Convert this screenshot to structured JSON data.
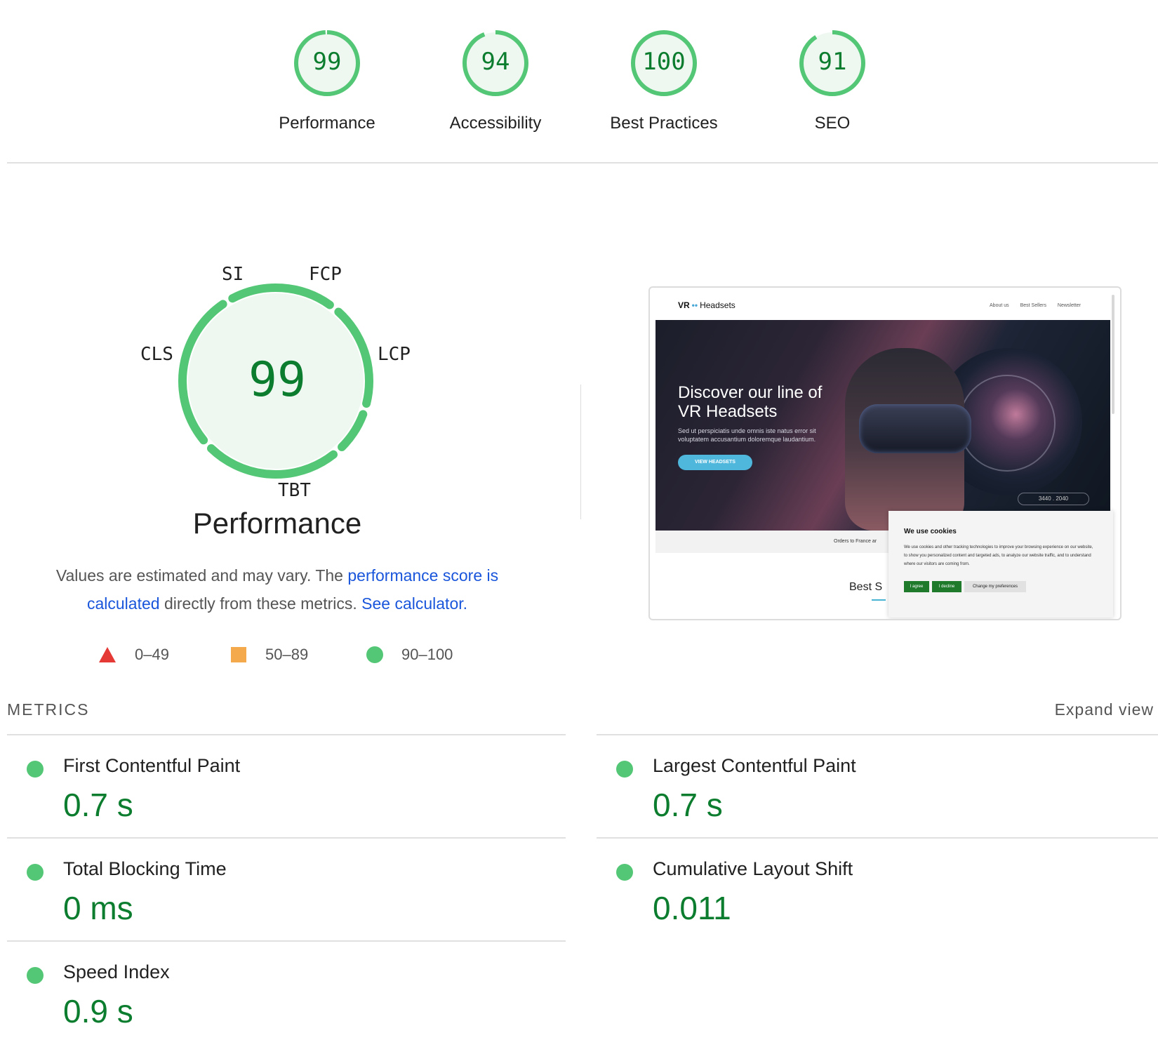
{
  "categories": [
    {
      "score": "99",
      "label": "Performance"
    },
    {
      "score": "94",
      "label": "Accessibility"
    },
    {
      "score": "100",
      "label": "Best Practices"
    },
    {
      "score": "91",
      "label": "SEO"
    }
  ],
  "performance": {
    "score": "99",
    "title": "Performance",
    "gauge_labels": {
      "si": "SI",
      "fcp": "FCP",
      "cls": "CLS",
      "lcp": "LCP",
      "tbt": "TBT"
    },
    "desc_pre": "Values are estimated and may vary. The ",
    "desc_link1": "performance score is calculated",
    "desc_mid": " directly from these metrics. ",
    "desc_link2": "See calculator."
  },
  "legend": [
    {
      "icon": "triangle-icon",
      "range": "0–49",
      "color": "#e53935"
    },
    {
      "icon": "square-icon",
      "range": "50–89",
      "color": "#f4a94c"
    },
    {
      "icon": "circle-icon",
      "range": "90–100",
      "color": "#53c775"
    }
  ],
  "screenshot": {
    "brand_a": "VR",
    "brand_dots": "••",
    "brand_b": "Headsets",
    "menu": [
      "About us",
      "Best Sellers",
      "Newsletter"
    ],
    "hero_title_1": "Discover our line of",
    "hero_title_2": "VR Headsets",
    "hero_sub": "Sed ut perspiciatis unde omnis iste natus error sit voluptatem accusantium doloremque laudantium.",
    "cta": "VIEW HEADSETS",
    "badge": "3440 . 2040",
    "strip_text": "Orders to France ar",
    "best": "Best S",
    "cookie_title": "We use cookies",
    "cookie_body": "We use cookies and other tracking technologies to improve your browsing experience on our website, to show you personalized content and targeted ads, to analyze our website traffic, and to understand where our visitors are coming from.",
    "cookie_buttons": [
      "I agree",
      "I decline",
      "Change my preferences"
    ]
  },
  "metrics": {
    "title": "METRICS",
    "expand": "Expand view",
    "items": [
      {
        "label": "First Contentful Paint",
        "value": "0.7 s"
      },
      {
        "label": "Largest Contentful Paint",
        "value": "0.7 s"
      },
      {
        "label": "Total Blocking Time",
        "value": "0 ms"
      },
      {
        "label": "Cumulative Layout Shift",
        "value": "0.011"
      },
      {
        "label": "Speed Index",
        "value": "0.9 s"
      }
    ]
  },
  "colors": {
    "pass": "#0c7d2e",
    "pass_ring": "#53c775",
    "pass_bg": "#eef8f1",
    "link": "#1a56db"
  }
}
